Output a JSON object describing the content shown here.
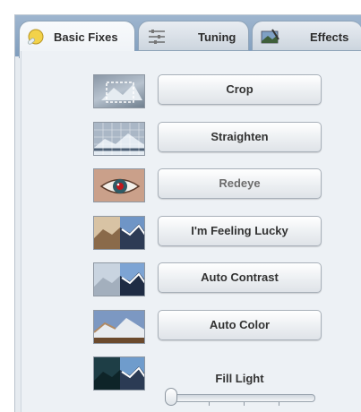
{
  "tabs": [
    {
      "label": "Basic Fixes",
      "icon": "bandage-icon",
      "active": true
    },
    {
      "label": "Tuning",
      "icon": "sliders-icon",
      "active": false
    },
    {
      "label": "Effects",
      "icon": "paintbrush-icon",
      "active": false
    }
  ],
  "buttons": {
    "crop": "Crop",
    "straighten": "Straighten",
    "redeye": "Redeye",
    "feeling_lucky": "I'm Feeling Lucky",
    "auto_contrast": "Auto Contrast",
    "auto_color": "Auto Color"
  },
  "fill_light": {
    "label": "Fill Light",
    "value": 0
  },
  "colors": {
    "accent": "#8fa9c5",
    "panel": "#edf1f5"
  }
}
